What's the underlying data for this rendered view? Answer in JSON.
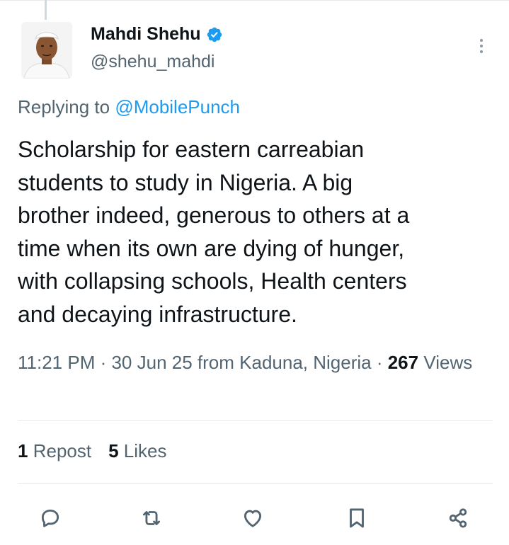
{
  "tweet": {
    "author": {
      "display_name": "Mahdi Shehu",
      "handle": "@shehu_mahdi",
      "verified": true
    },
    "replying_prefix": "Replying to ",
    "replying_to": "@MobilePunch",
    "text": "Scholarship for eastern carreabian\nstudents to study in Nigeria. A big\nbrother indeed, generous to others at a\ntime when its own are dying of hunger,\nwith collapsing schools, Health centers\nand decaying infrastructure.",
    "time": "11:21 PM",
    "date": "30 Jun 25",
    "location": "from Kaduna, Nigeria",
    "views_count": "267",
    "views_label": "Views",
    "separator": " · "
  },
  "stats": {
    "repost_count": "1",
    "repost_label": "Repost",
    "likes_count": "5",
    "likes_label": "Likes"
  },
  "icons": {
    "verified": "verified-badge-icon",
    "more": "more-options-icon",
    "reply": "reply-icon",
    "repost": "repost-icon",
    "like": "like-icon",
    "bookmark": "bookmark-icon",
    "share": "share-icon"
  },
  "colors": {
    "accent": "#1d9bf0",
    "text_primary": "#0f1419",
    "text_secondary": "#536471",
    "divider": "#e7e9ea"
  }
}
